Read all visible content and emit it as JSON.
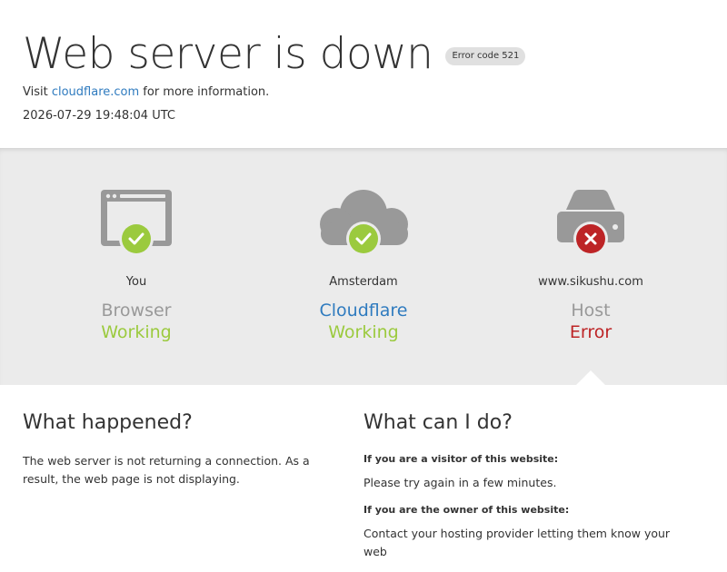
{
  "header": {
    "title": "Web server is down",
    "error_badge": "Error code 521",
    "visit_prefix": "Visit ",
    "visit_link": "cloudflare.com",
    "visit_suffix": " for more information.",
    "timestamp": "2026-07-29 19:48:04 UTC"
  },
  "nodes": [
    {
      "location": "You",
      "kind": "Browser",
      "status": "Working",
      "icon": "browser-icon",
      "state": "ok"
    },
    {
      "location": "Amsterdam",
      "kind": "Cloudflare",
      "status": "Working",
      "icon": "cloud-icon",
      "state": "ok"
    },
    {
      "location": "www.sikushu.com",
      "kind": "Host",
      "status": "Error",
      "icon": "server-icon",
      "state": "error"
    }
  ],
  "what_happened": {
    "heading": "What happened?",
    "body": "The web server is not returning a connection. As a result, the web page is not displaying."
  },
  "what_can_i_do": {
    "heading": "What can I do?",
    "visitor_heading": "If you are a visitor of this website:",
    "visitor_body": "Please try again in a few minutes.",
    "owner_heading": "If you are the owner of this website:",
    "owner_body": "Contact your hosting provider letting them know your web"
  },
  "colors": {
    "ok": "#9bca3e",
    "error": "#bd2426",
    "link": "#2f7bbf",
    "icon_gray": "#999999"
  }
}
